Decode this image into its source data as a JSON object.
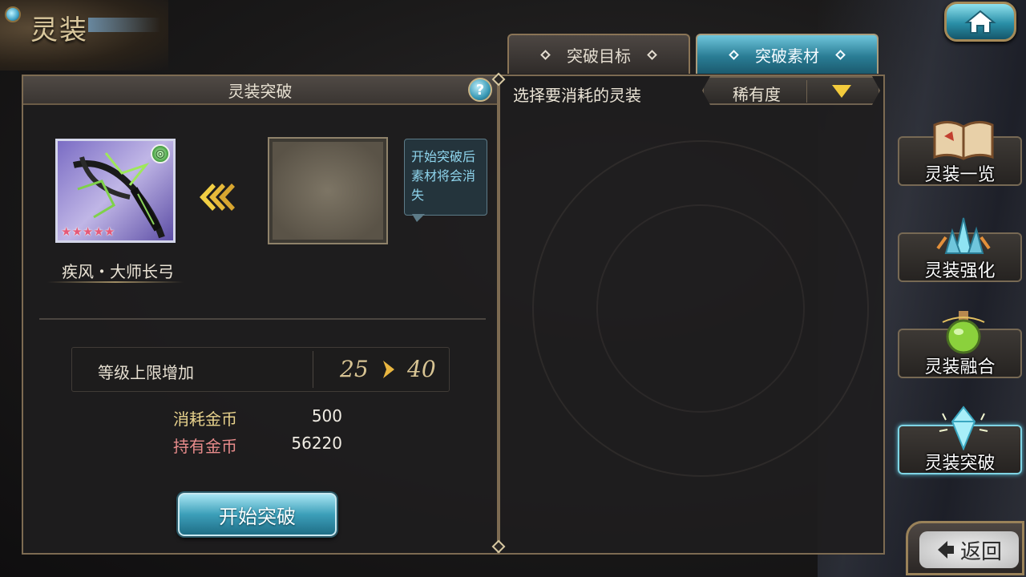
{
  "header": {
    "title": "灵装"
  },
  "tabs": [
    {
      "label": "突破目标",
      "active": false
    },
    {
      "label": "突破素材",
      "active": true
    }
  ],
  "left_panel": {
    "title": "灵装突破",
    "help_label": "?",
    "item": {
      "name": "疾风・大师长弓",
      "rarity_stars": 5,
      "badge_icon": "wind-element-icon"
    },
    "tooltip": "开始突破后素材将会消失",
    "level": {
      "label": "等级上限增加",
      "from": "25",
      "to": "40"
    },
    "cost": {
      "label": "消耗金币",
      "value": "500"
    },
    "owned": {
      "label": "持有金币",
      "value": "56220"
    },
    "start_button": "开始突破"
  },
  "right_panel": {
    "prompt": "选择要消耗的灵装",
    "sort_label": "稀有度"
  },
  "side_menu": [
    {
      "label": "灵装一览",
      "icon": "book-icon",
      "active": false
    },
    {
      "label": "灵装强化",
      "icon": "crystal-cluster-icon",
      "active": false
    },
    {
      "label": "灵装融合",
      "icon": "potion-flask-icon",
      "active": false
    },
    {
      "label": "灵装突破",
      "icon": "crystal-break-icon",
      "active": true
    }
  ],
  "back_button": "返回",
  "colors": {
    "accent_cyan": "#3c9fb9",
    "gold_text": "#d8c493",
    "owned_red": "#e88b8b",
    "cost_yellow": "#e8d28c",
    "star_pink": "#e55a78",
    "sort_arrow": "#f3cb3c"
  }
}
